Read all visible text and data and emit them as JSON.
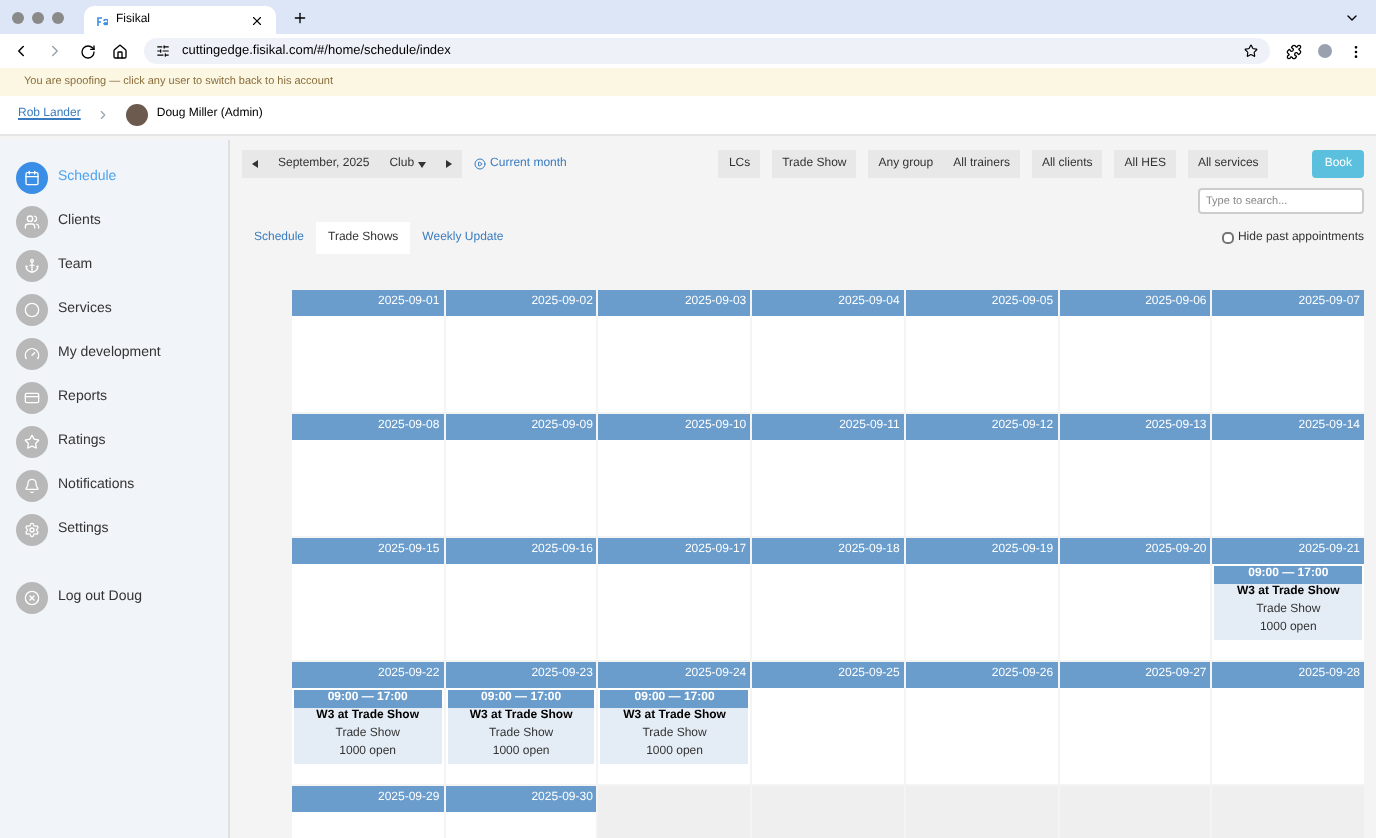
{
  "browser": {
    "tab_title": "Fisikal",
    "url": "cuttingedge.fisikal.com/#/home/schedule/index"
  },
  "banner": "You are spoofing — click any user to switch back to his account",
  "breadcrumb": {
    "link": "Rob Lander",
    "current": "Doug Miller (Admin)"
  },
  "sidebar": {
    "items": [
      {
        "label": "Schedule",
        "selected": true
      },
      {
        "label": "Clients",
        "selected": false
      },
      {
        "label": "Team",
        "selected": false
      },
      {
        "label": "Services",
        "selected": false
      },
      {
        "label": "My development",
        "selected": false
      },
      {
        "label": "Reports",
        "selected": false
      },
      {
        "label": "Ratings",
        "selected": false
      },
      {
        "label": "Notifications",
        "selected": false
      },
      {
        "label": "Settings",
        "selected": false
      }
    ],
    "logout": "Log out Doug"
  },
  "toolbar": {
    "month": "September, 2025",
    "location": "Club",
    "current_month": "Current month",
    "filters": [
      [
        "LCs"
      ],
      [
        "Trade Show"
      ],
      [
        "Any group",
        "All trainers"
      ],
      [
        "All clients"
      ],
      [
        "All HES"
      ],
      [
        "All services"
      ]
    ],
    "book": "Book",
    "search_placeholder": "Type to search..."
  },
  "tabs": [
    {
      "label": "Schedule",
      "selected": false
    },
    {
      "label": "Trade Shows",
      "selected": true
    },
    {
      "label": "Weekly Update",
      "selected": false
    }
  ],
  "hide_past": {
    "label": "Hide past appointments",
    "checked": false
  },
  "calendar": {
    "weeks": [
      [
        {
          "date": "2025-09-01"
        },
        {
          "date": "2025-09-02"
        },
        {
          "date": "2025-09-03"
        },
        {
          "date": "2025-09-04"
        },
        {
          "date": "2025-09-05"
        },
        {
          "date": "2025-09-06"
        },
        {
          "date": "2025-09-07"
        }
      ],
      [
        {
          "date": "2025-09-08"
        },
        {
          "date": "2025-09-09"
        },
        {
          "date": "2025-09-10"
        },
        {
          "date": "2025-09-11"
        },
        {
          "date": "2025-09-12"
        },
        {
          "date": "2025-09-13"
        },
        {
          "date": "2025-09-14"
        }
      ],
      [
        {
          "date": "2025-09-15"
        },
        {
          "date": "2025-09-16"
        },
        {
          "date": "2025-09-17"
        },
        {
          "date": "2025-09-18"
        },
        {
          "date": "2025-09-19"
        },
        {
          "date": "2025-09-20"
        },
        {
          "date": "2025-09-21",
          "events": [
            {
              "time": "09:00 — 17:00",
              "title": "W3 at Trade Show",
              "service": "Trade Show",
              "capacity": "1000 open"
            }
          ]
        }
      ],
      [
        {
          "date": "2025-09-22",
          "events": [
            {
              "time": "09:00 — 17:00",
              "title": "W3 at Trade Show",
              "service": "Trade Show",
              "capacity": "1000 open"
            }
          ]
        },
        {
          "date": "2025-09-23",
          "events": [
            {
              "time": "09:00 — 17:00",
              "title": "W3 at Trade Show",
              "service": "Trade Show",
              "capacity": "1000 open"
            }
          ]
        },
        {
          "date": "2025-09-24",
          "events": [
            {
              "time": "09:00 — 17:00",
              "title": "W3 at Trade Show",
              "service": "Trade Show",
              "capacity": "1000 open"
            }
          ]
        },
        {
          "date": "2025-09-25"
        },
        {
          "date": "2025-09-26"
        },
        {
          "date": "2025-09-27"
        },
        {
          "date": "2025-09-28"
        }
      ],
      [
        {
          "date": "2025-09-29"
        },
        {
          "date": "2025-09-30"
        }
      ]
    ]
  }
}
